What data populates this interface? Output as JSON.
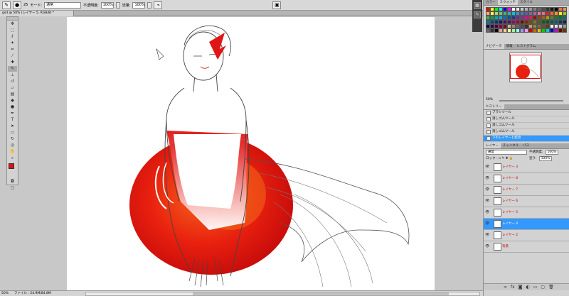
{
  "options_bar": {
    "brush_size": "25",
    "mode_label": "モード:",
    "mode_value": "通常",
    "opacity_label": "不透明度:",
    "opacity_value": "100%",
    "flow_label": "流量:",
    "flow_value": "100%"
  },
  "document_tab": "gsd @ 50% (レイヤー 5, RGB/8) *",
  "status": {
    "zoom": "50%",
    "file_info": "ファイル : 24.9M/84.8M"
  },
  "swatches_panel": {
    "tabs": [
      "カラー",
      "スウォッチ",
      "スタイル"
    ],
    "colors": [
      "#ff0000",
      "#ffff00",
      "#00ff00",
      "#00ffff",
      "#0000ff",
      "#ff00ff",
      "#ffffff",
      "#e6e6e6",
      "#cccccc",
      "#b3b3b3",
      "#999999",
      "#808080",
      "#666666",
      "#4d4d4d",
      "#333333",
      "#1a1a1a",
      "#000000",
      "#f26c4f",
      "#f68e55",
      "#fbaf5c",
      "#fff467",
      "#acd372",
      "#7cc576",
      "#3bb878",
      "#1abbb4",
      "#00bff3",
      "#438cca",
      "#5574b9",
      "#605ca8",
      "#855fa8",
      "#a763a8",
      "#f06ea9",
      "#f26d7d",
      "#ed1c24",
      "#f26522",
      "#f7941d",
      "#fff200",
      "#8dc63f",
      "#39b54a",
      "#00a651",
      "#00a99d",
      "#00aeef",
      "#0072bc",
      "#0054a6",
      "#2e3192",
      "#662d91",
      "#92278f",
      "#ec008c",
      "#ed145b",
      "#9e0b0f",
      "#a0410d",
      "#a36209",
      "#aba000",
      "#598527",
      "#1a7b30",
      "#007236",
      "#00746b",
      "#0076a3",
      "#004b80",
      "#003471",
      "#1b1464",
      "#440e62",
      "#630460",
      "#9e005d",
      "#9e0039",
      "#790000",
      "#7b2e00",
      "#7d4900",
      "#827b00",
      "#406618",
      "#005e20",
      "#005826",
      "#005952",
      "#005b7f",
      "#003663",
      "#002157",
      "#0d004c",
      "#32004b",
      "#4b0049",
      "#7b0046",
      "#7a0026",
      "#c7b299",
      "#998675",
      "#736357",
      "#534741",
      "#37302a",
      "#c69c6d",
      "#a67c52",
      "#8c6239",
      "#754c24",
      "#603913",
      "#ffffff",
      "#e6e6e6",
      "#cccccc",
      "#999999",
      "#666666",
      "#333333",
      "#000000",
      "#ff9999",
      "#ffcc99",
      "#ffff99",
      "#99ff99",
      "#99ffff",
      "#9999ff",
      "#ff99ff",
      "#cc0000",
      "#cc6600",
      "#cccc00",
      "#00cc00",
      "#00cccc",
      "#0000cc",
      "#cc00cc",
      "#660000",
      "#663300"
    ]
  },
  "navigator_panel": {
    "tabs": [
      "ナビゲータ",
      "情報",
      "ヒストグラム"
    ],
    "zoom": "50%"
  },
  "history_panel": {
    "tab": "ヒストリー",
    "items": [
      "ブラシツール",
      "消しゴムツール",
      "消しゴムツール",
      "消しゴムツール",
      "下のレイヤーと結合"
    ],
    "selected_index": 4
  },
  "layers_panel": {
    "tabs": [
      "レイヤー",
      "チャンネル",
      "パス"
    ],
    "blend_mode": "通常",
    "opacity_label": "不透明度:",
    "opacity_value": "100%",
    "lock_label": "ロック:",
    "fill_label": "塗り:",
    "fill_value": "100%",
    "layers": [
      {
        "name": "レイヤー 3",
        "selected": false
      },
      {
        "name": "レイヤー 8",
        "selected": false
      },
      {
        "name": "レイヤー 7",
        "selected": false
      },
      {
        "name": "レイヤー 6",
        "selected": false
      },
      {
        "name": "レイヤー 5",
        "selected": false
      },
      {
        "name": "レイヤー 4",
        "selected": true
      },
      {
        "name": "レイヤー 2",
        "selected": false
      },
      {
        "name": "背景",
        "selected": false
      }
    ]
  },
  "colors": {
    "accent": "#3399ff",
    "foreground_swatch": "#dd1111"
  }
}
